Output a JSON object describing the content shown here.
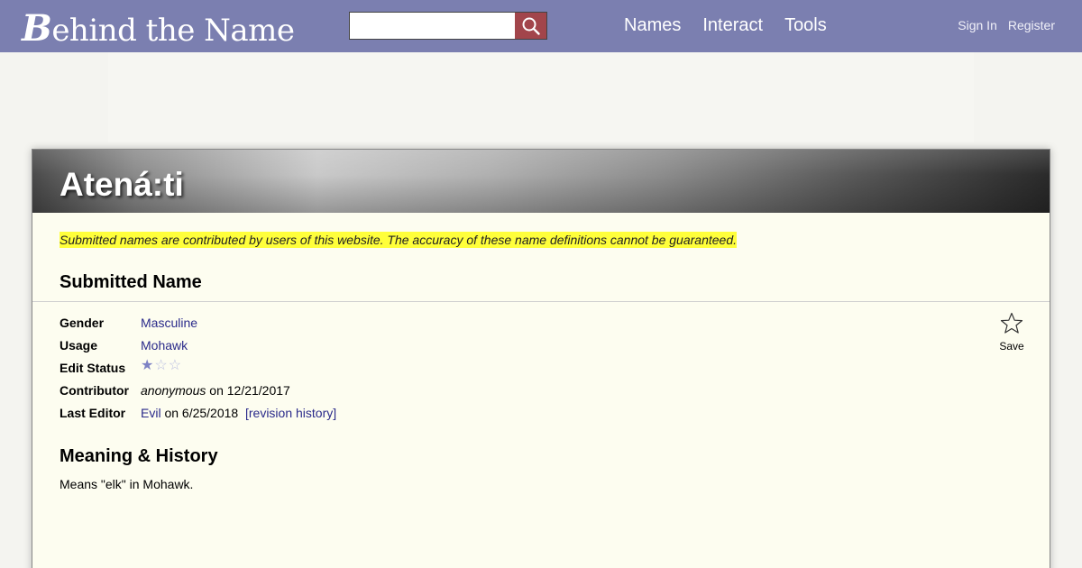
{
  "site": {
    "logo_b": "B",
    "logo_rest": "ehind the Name"
  },
  "search": {
    "placeholder": "",
    "value": ""
  },
  "nav": [
    {
      "label": "Names"
    },
    {
      "label": "Interact"
    },
    {
      "label": "Tools"
    }
  ],
  "auth": {
    "sign_in": "Sign In",
    "register": "Register"
  },
  "page": {
    "name": "Atená:ti",
    "disclaimer": "Submitted names are contributed by users of this website. The accuracy of these name definitions cannot be guaranteed.",
    "section_submitted": "Submitted Name",
    "info": {
      "gender_label": "Gender",
      "gender_value": "Masculine",
      "usage_label": "Usage",
      "usage_value": "Mohawk",
      "edit_status_label": "Edit Status",
      "edit_status_rating": 1,
      "edit_status_max": 3,
      "contributor_label": "Contributor",
      "contributor_name": "anonymous",
      "contributor_date": "on 12/21/2017",
      "last_editor_label": "Last Editor",
      "last_editor_name": "Evil",
      "last_editor_date": "on 6/25/2018",
      "revision_link": "[revision history]"
    },
    "save_label": "Save",
    "section_meaning": "Meaning & History",
    "meaning_text": "Means \"elk\" in Mohawk."
  },
  "colors": {
    "topbar": "#7b7fb0",
    "search_button": "#a2454b",
    "highlight": "#ffff3b",
    "link": "#2a2a8a",
    "card_bg": "#fdfdf0"
  }
}
